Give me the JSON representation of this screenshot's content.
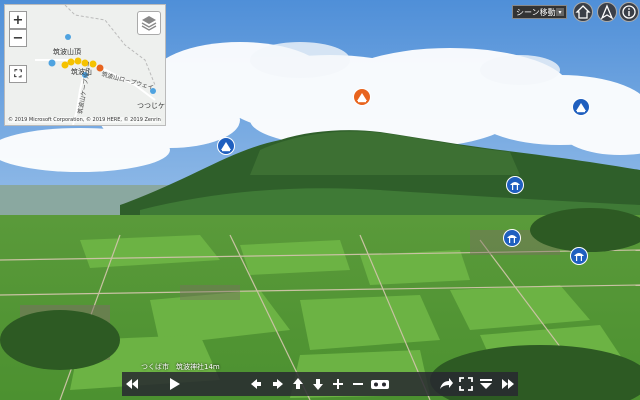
{
  "minimap": {
    "zoom_in": "+",
    "zoom_out": "−",
    "fullscreen": "⛶",
    "place_label": "筑波山頂",
    "place_label2": "筑波山",
    "place_label3": "つつじケ",
    "road_label1": "筑波山ロープウェイ",
    "road_label2": "筑波山ケーブルカー",
    "copyright": "© 2019 Microsoft Corporation, © 2019 HERE, © 2019 Zenrin"
  },
  "header": {
    "scene_select": "シーン移動",
    "scene_arrow": "▾"
  },
  "caption": {
    "location": "つくば市　筑波神社14m"
  },
  "colors": {
    "marker_blue": "#1f5fbf",
    "marker_orange": "#e8641e",
    "bar_bg": "#28282f"
  },
  "icons": {
    "nav": [
      "rewind-icon",
      "play-icon",
      "arrow-left-icon",
      "arrow-right-icon",
      "arrow-up-icon",
      "arrow-down-icon",
      "zoom-in-icon",
      "zoom-out-icon",
      "vr-icon",
      "share-icon",
      "fullscreen-icon",
      "collapse-icon",
      "fast-forward-icon"
    ]
  }
}
